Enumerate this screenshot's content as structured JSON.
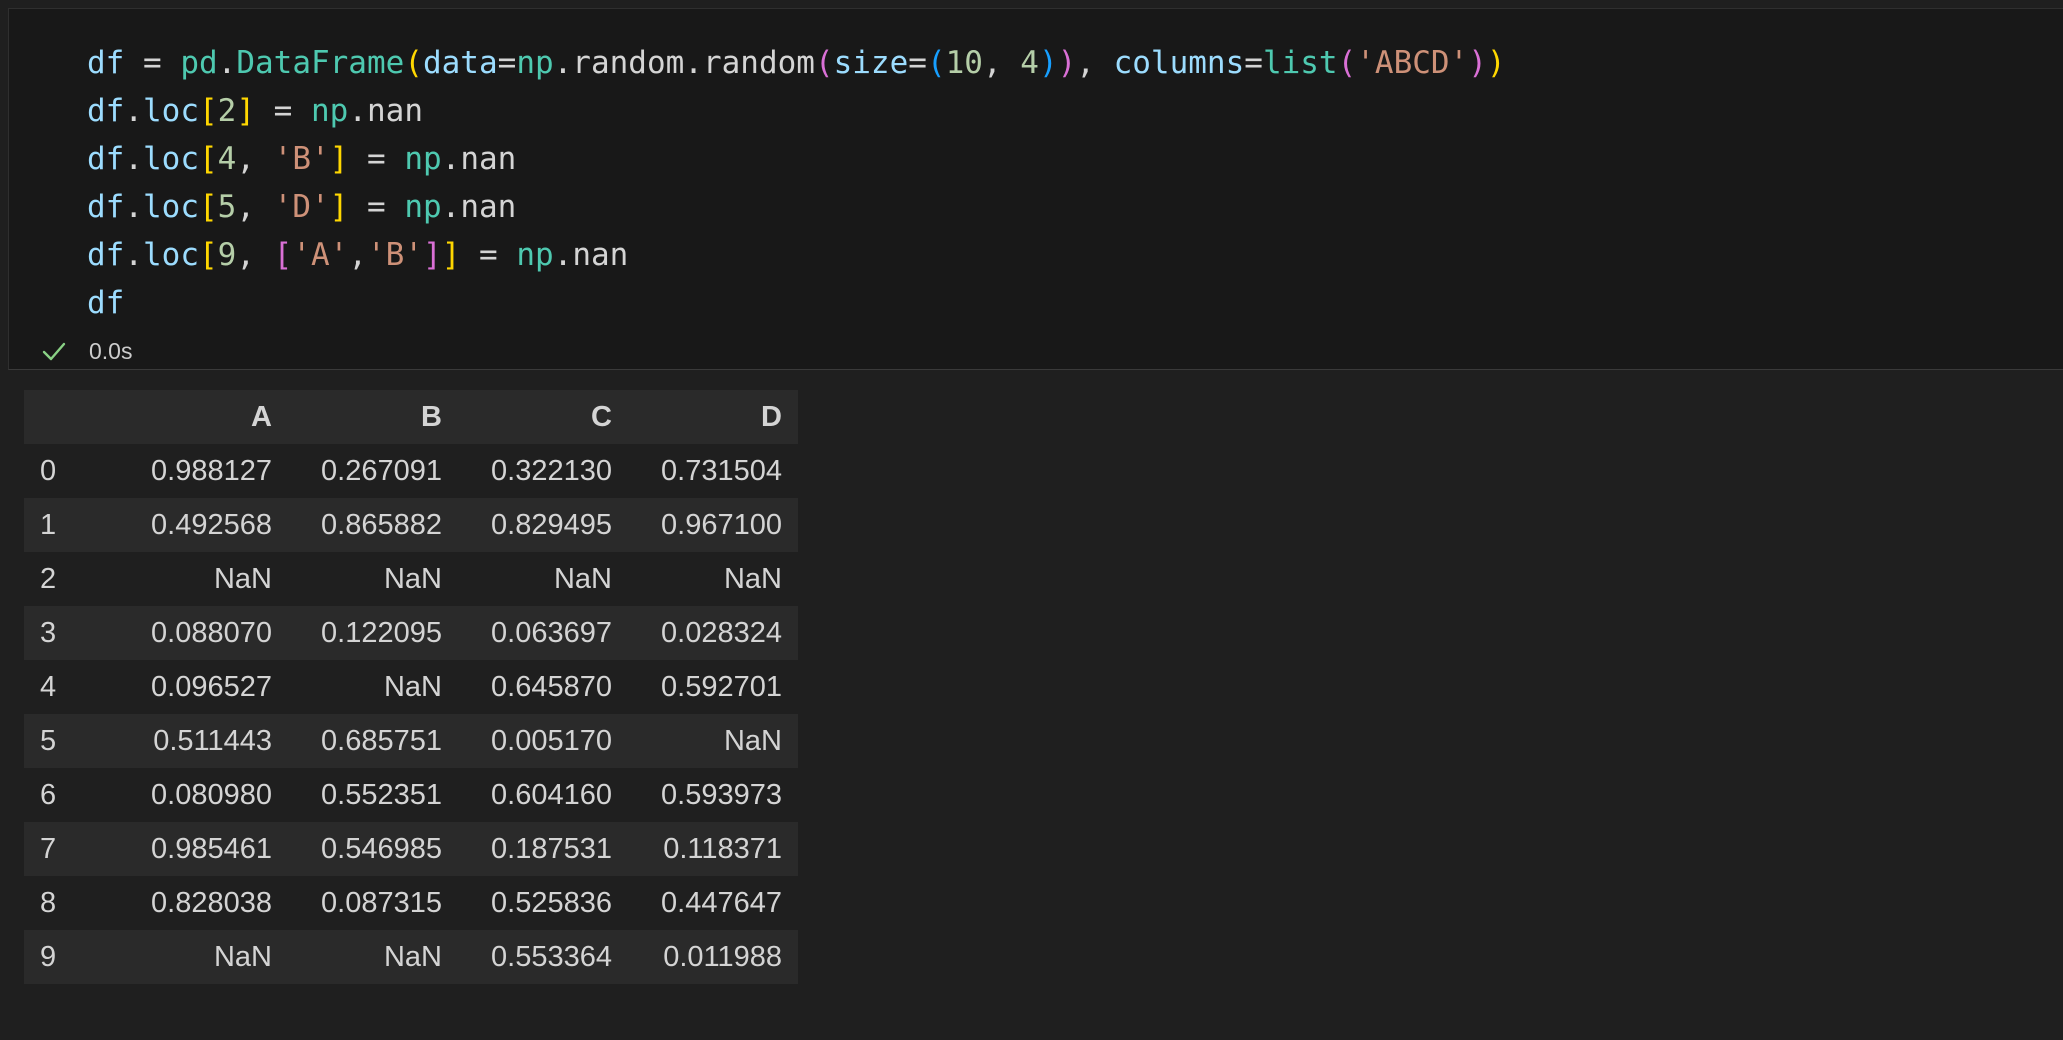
{
  "code_lines": [
    [
      {
        "t": "df",
        "c": "#9cdcfe"
      },
      {
        "t": " = ",
        "c": "#d4d4d4"
      },
      {
        "t": "pd",
        "c": "#4ec9b0"
      },
      {
        "t": ".",
        "c": "#d4d4d4"
      },
      {
        "t": "DataFrame",
        "c": "#4ec9b0"
      },
      {
        "t": "(",
        "c": "#ffd700"
      },
      {
        "t": "data",
        "c": "#9cdcfe"
      },
      {
        "t": "=",
        "c": "#d4d4d4"
      },
      {
        "t": "np",
        "c": "#4ec9b0"
      },
      {
        "t": ".random.random",
        "c": "#d4d4d4"
      },
      {
        "t": "(",
        "c": "#da70d6"
      },
      {
        "t": "size",
        "c": "#9cdcfe"
      },
      {
        "t": "=",
        "c": "#d4d4d4"
      },
      {
        "t": "(",
        "c": "#179fff"
      },
      {
        "t": "10",
        "c": "#b5cea8"
      },
      {
        "t": ", ",
        "c": "#d4d4d4"
      },
      {
        "t": "4",
        "c": "#b5cea8"
      },
      {
        "t": ")",
        "c": "#179fff"
      },
      {
        "t": ")",
        "c": "#da70d6"
      },
      {
        "t": ", ",
        "c": "#d4d4d4"
      },
      {
        "t": "columns",
        "c": "#9cdcfe"
      },
      {
        "t": "=",
        "c": "#d4d4d4"
      },
      {
        "t": "list",
        "c": "#4ec9b0"
      },
      {
        "t": "(",
        "c": "#da70d6"
      },
      {
        "t": "'ABCD'",
        "c": "#ce9178"
      },
      {
        "t": ")",
        "c": "#da70d6"
      },
      {
        "t": ")",
        "c": "#ffd700"
      }
    ],
    [
      {
        "t": "df",
        "c": "#9cdcfe"
      },
      {
        "t": ".",
        "c": "#d4d4d4"
      },
      {
        "t": "loc",
        "c": "#9cdcfe"
      },
      {
        "t": "[",
        "c": "#ffd700"
      },
      {
        "t": "2",
        "c": "#b5cea8"
      },
      {
        "t": "]",
        "c": "#ffd700"
      },
      {
        "t": " = ",
        "c": "#d4d4d4"
      },
      {
        "t": "np",
        "c": "#4ec9b0"
      },
      {
        "t": ".nan",
        "c": "#d4d4d4"
      }
    ],
    [
      {
        "t": "df",
        "c": "#9cdcfe"
      },
      {
        "t": ".",
        "c": "#d4d4d4"
      },
      {
        "t": "loc",
        "c": "#9cdcfe"
      },
      {
        "t": "[",
        "c": "#ffd700"
      },
      {
        "t": "4",
        "c": "#b5cea8"
      },
      {
        "t": ", ",
        "c": "#d4d4d4"
      },
      {
        "t": "'B'",
        "c": "#ce9178"
      },
      {
        "t": "]",
        "c": "#ffd700"
      },
      {
        "t": " = ",
        "c": "#d4d4d4"
      },
      {
        "t": "np",
        "c": "#4ec9b0"
      },
      {
        "t": ".nan",
        "c": "#d4d4d4"
      }
    ],
    [
      {
        "t": "df",
        "c": "#9cdcfe"
      },
      {
        "t": ".",
        "c": "#d4d4d4"
      },
      {
        "t": "loc",
        "c": "#9cdcfe"
      },
      {
        "t": "[",
        "c": "#ffd700"
      },
      {
        "t": "5",
        "c": "#b5cea8"
      },
      {
        "t": ", ",
        "c": "#d4d4d4"
      },
      {
        "t": "'D'",
        "c": "#ce9178"
      },
      {
        "t": "]",
        "c": "#ffd700"
      },
      {
        "t": " = ",
        "c": "#d4d4d4"
      },
      {
        "t": "np",
        "c": "#4ec9b0"
      },
      {
        "t": ".nan",
        "c": "#d4d4d4"
      }
    ],
    [
      {
        "t": "df",
        "c": "#9cdcfe"
      },
      {
        "t": ".",
        "c": "#d4d4d4"
      },
      {
        "t": "loc",
        "c": "#9cdcfe"
      },
      {
        "t": "[",
        "c": "#ffd700"
      },
      {
        "t": "9",
        "c": "#b5cea8"
      },
      {
        "t": ", ",
        "c": "#d4d4d4"
      },
      {
        "t": "[",
        "c": "#da70d6"
      },
      {
        "t": "'A'",
        "c": "#ce9178"
      },
      {
        "t": ",",
        "c": "#d4d4d4"
      },
      {
        "t": "'B'",
        "c": "#ce9178"
      },
      {
        "t": "]",
        "c": "#da70d6"
      },
      {
        "t": "]",
        "c": "#ffd700"
      },
      {
        "t": " = ",
        "c": "#d4d4d4"
      },
      {
        "t": "np",
        "c": "#4ec9b0"
      },
      {
        "t": ".nan",
        "c": "#d4d4d4"
      }
    ],
    [
      {
        "t": "df",
        "c": "#9cdcfe"
      }
    ]
  ],
  "execution": {
    "status_icon": "check-icon",
    "status_color": "#89d185",
    "duration": "0.0s"
  },
  "dataframe": {
    "columns": [
      "A",
      "B",
      "C",
      "D"
    ],
    "rows": [
      {
        "index": "0",
        "values": [
          "0.988127",
          "0.267091",
          "0.322130",
          "0.731504"
        ]
      },
      {
        "index": "1",
        "values": [
          "0.492568",
          "0.865882",
          "0.829495",
          "0.967100"
        ]
      },
      {
        "index": "2",
        "values": [
          "NaN",
          "NaN",
          "NaN",
          "NaN"
        ]
      },
      {
        "index": "3",
        "values": [
          "0.088070",
          "0.122095",
          "0.063697",
          "0.028324"
        ]
      },
      {
        "index": "4",
        "values": [
          "0.096527",
          "NaN",
          "0.645870",
          "0.592701"
        ]
      },
      {
        "index": "5",
        "values": [
          "0.511443",
          "0.685751",
          "0.005170",
          "NaN"
        ]
      },
      {
        "index": "6",
        "values": [
          "0.080980",
          "0.552351",
          "0.604160",
          "0.593973"
        ]
      },
      {
        "index": "7",
        "values": [
          "0.985461",
          "0.546985",
          "0.187531",
          "0.118371"
        ]
      },
      {
        "index": "8",
        "values": [
          "0.828038",
          "0.087315",
          "0.525836",
          "0.447647"
        ]
      },
      {
        "index": "9",
        "values": [
          "NaN",
          "NaN",
          "0.553364",
          "0.011988"
        ]
      }
    ]
  }
}
